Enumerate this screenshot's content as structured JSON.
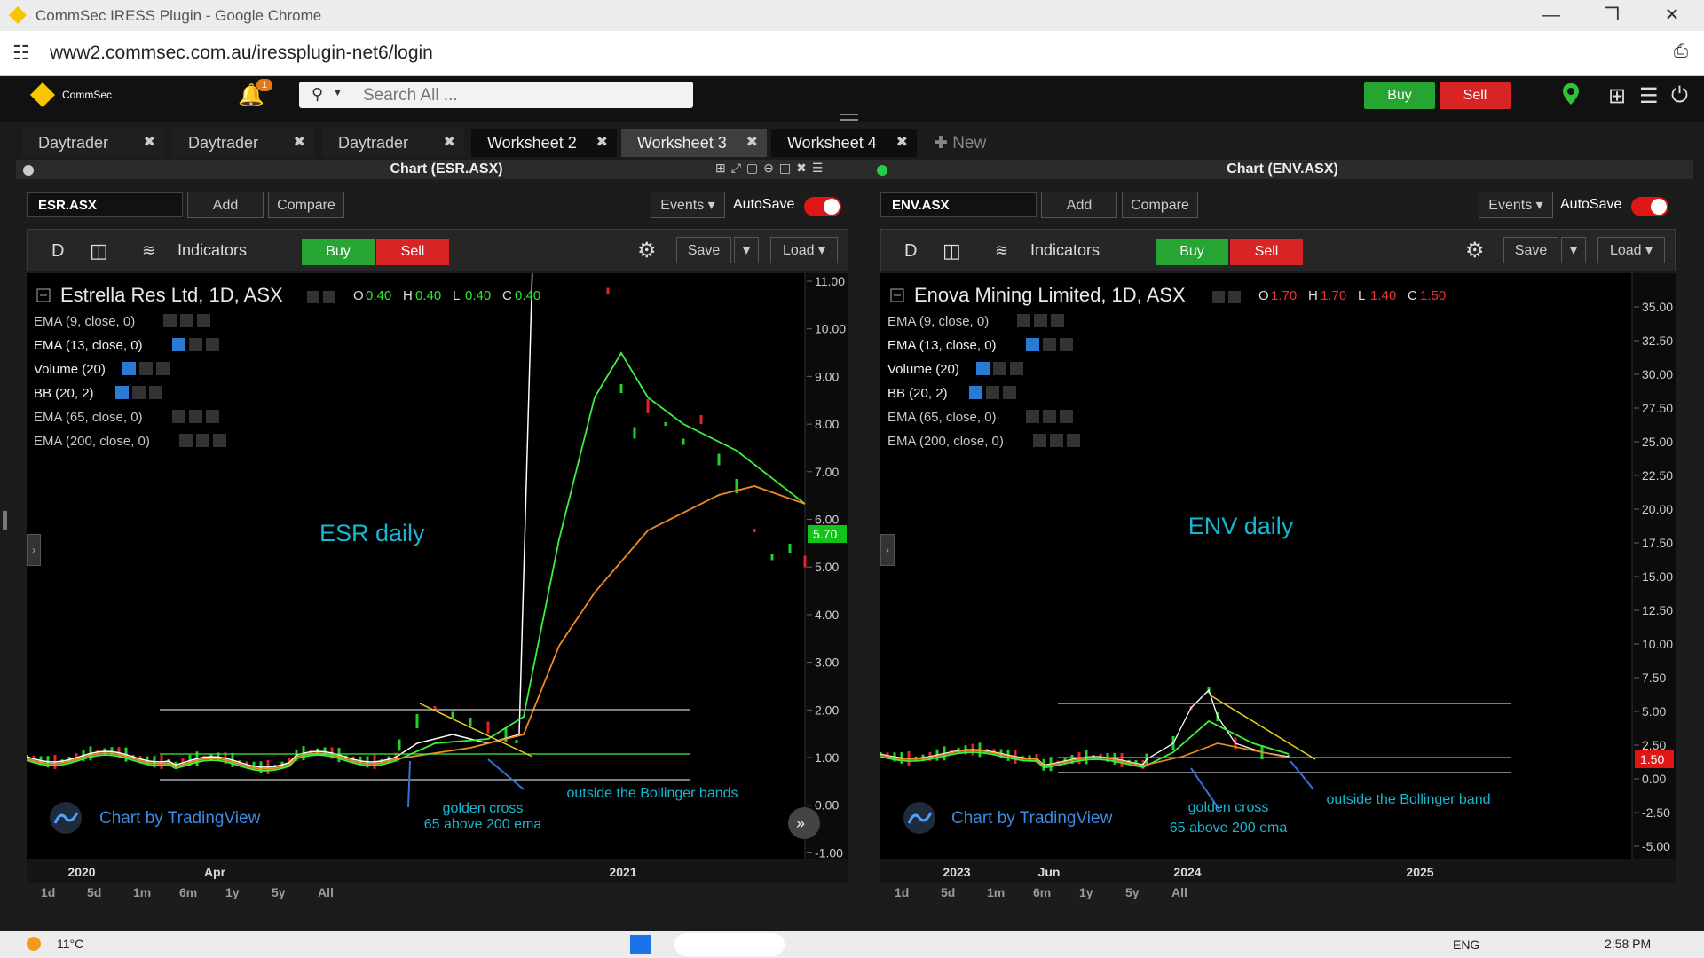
{
  "browser": {
    "window_title": "CommSec IRESS Plugin - Google Chrome",
    "url": "www2.commsec.com.au/iressplugin-net6/login"
  },
  "header": {
    "brand": "CommSec",
    "notification_count": "1",
    "search_placeholder": "Search All ...",
    "buy_label": "Buy",
    "sell_label": "Sell"
  },
  "tabs": [
    {
      "label": "Daytrader"
    },
    {
      "label": "Daytrader"
    },
    {
      "label": "Daytrader"
    },
    {
      "label": "Worksheet 2"
    },
    {
      "label": "Worksheet 3"
    },
    {
      "label": "Worksheet 4"
    }
  ],
  "new_tab_label": "New",
  "colors": {
    "buy": "#27a533",
    "sell": "#d82424",
    "ema9": "#ffffff",
    "ema13": "#9ae234",
    "ema65": "#3ef03e",
    "ema200": "#f08a24",
    "bb_line": "#c9c9c9",
    "annotation": "#19b6d2",
    "trend": "#e6d21f"
  },
  "panels": [
    {
      "title": "Chart (ESR.ASX)",
      "symbol": "ESR.ASX",
      "add_label": "Add",
      "compare_label": "Compare",
      "events_label": "Events",
      "autosave_label": "AutoSave",
      "interval": "D",
      "indicators_label": "Indicators",
      "buy_label": "Buy",
      "sell_label": "Sell",
      "save_label": "Save",
      "load_label": "Load",
      "instrument": "Estrella Res Ltd, 1D, ASX",
      "ohlc": {
        "o": "0.40",
        "h": "0.40",
        "l": "0.40",
        "c": "0.40"
      },
      "ohlc_color": "#2ee82e",
      "indicators": [
        "EMA (9, close, 0)",
        "EMA (13, close, 0)",
        "Volume (20)",
        "BB (20, 2)",
        "EMA (65, close, 0)",
        "EMA (200, close, 0)"
      ],
      "watermark_note": "ESR daily",
      "annotations": [
        "golden cross\n65 above 200 ema",
        "outside the Bollinger bands"
      ],
      "credit": "Chart by TradingView",
      "price_ticks": [
        "11.00",
        "10.00",
        "9.00",
        "8.00",
        "7.00",
        "6.00",
        "5.00",
        "4.00",
        "3.00",
        "2.00",
        "1.00",
        "0.00",
        "-1.00"
      ],
      "last_price": "5.70",
      "time_ticks": [
        "2020",
        "Apr",
        "2021"
      ],
      "ranges": [
        "1d",
        "5d",
        "1m",
        "6m",
        "1y",
        "5y",
        "All"
      ]
    },
    {
      "title": "Chart (ENV.ASX)",
      "symbol": "ENV.ASX",
      "add_label": "Add",
      "compare_label": "Compare",
      "events_label": "Events",
      "autosave_label": "AutoSave",
      "interval": "D",
      "indicators_label": "Indicators",
      "buy_label": "Buy",
      "sell_label": "Sell",
      "save_label": "Save",
      "load_label": "Load",
      "instrument": "Enova Mining Limited, 1D, ASX",
      "ohlc": {
        "o": "1.70",
        "h": "1.70",
        "l": "1.40",
        "c": "1.50"
      },
      "ohlc_color": "#f03030",
      "indicators": [
        "EMA (9, close, 0)",
        "EMA (13, close, 0)",
        "Volume (20)",
        "BB (20, 2)",
        "EMA (65, close, 0)",
        "EMA (200, close, 0)"
      ],
      "watermark_note": "ENV daily",
      "annotations": [
        "golden cross\n65 above 200 ema",
        "outside the Bollinger band"
      ],
      "credit": "Chart by TradingView",
      "price_ticks": [
        "35.00",
        "32.50",
        "30.00",
        "27.50",
        "25.00",
        "22.50",
        "20.00",
        "17.50",
        "15.00",
        "12.50",
        "10.00",
        "7.50",
        "5.00",
        "2.50",
        "0.00",
        "-2.50",
        "-5.00"
      ],
      "last_price": "1.50",
      "time_ticks": [
        "2023",
        "Jun",
        "2024",
        "2025"
      ],
      "ranges": [
        "1d",
        "5d",
        "1m",
        "6m",
        "1y",
        "5y",
        "All"
      ]
    }
  ],
  "taskbar": {
    "weather": "11°C",
    "language": "ENG",
    "time": "2:58 PM"
  }
}
